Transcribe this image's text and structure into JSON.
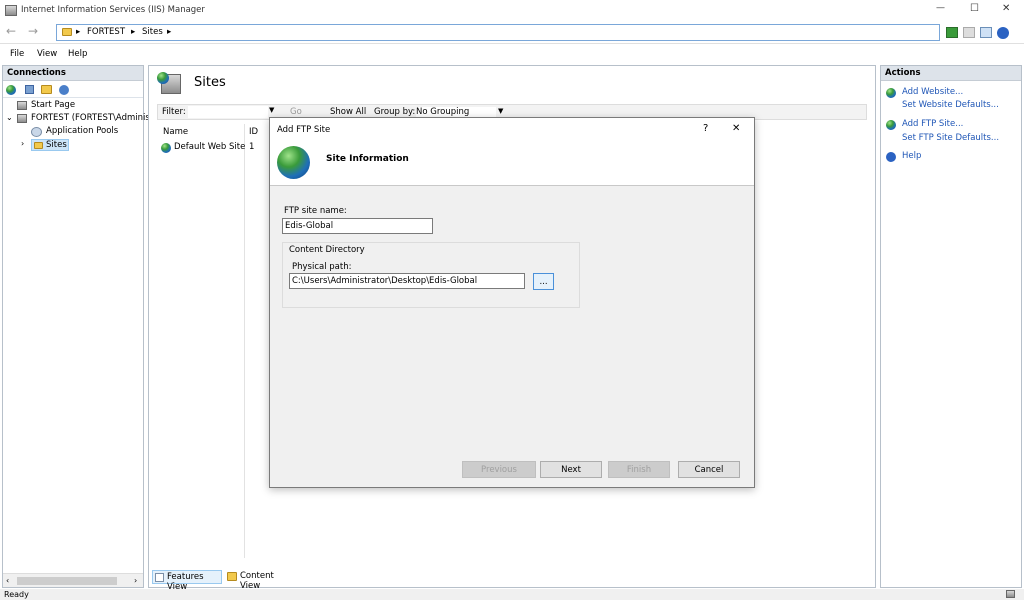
{
  "window": {
    "title": "Internet Information Services (IIS) Manager",
    "controls": {
      "minimize": "—",
      "maximize": "☐",
      "close": "✕"
    }
  },
  "address": {
    "back": "←",
    "forward": "→",
    "segments": [
      "FORTEST",
      "Sites"
    ],
    "sep": "▸"
  },
  "menu": [
    "File",
    "View",
    "Help"
  ],
  "connections": {
    "title": "Connections",
    "tree": {
      "start_page": "Start Page",
      "server": "FORTEST (FORTEST\\Administ",
      "app_pools": "Application Pools",
      "sites": "Sites"
    }
  },
  "sites": {
    "title": "Sites",
    "filter_label": "Filter:",
    "go_label": "Go",
    "show_all_label": "Show All",
    "group_by_label": "Group by:",
    "group_by_value": "No Grouping",
    "columns": {
      "name": "Name",
      "id": "ID"
    },
    "rows": [
      {
        "name": "Default Web Site",
        "id": "1"
      }
    ]
  },
  "views": {
    "features": "Features View",
    "content": "Content View"
  },
  "actions": {
    "title": "Actions",
    "add_website": "Add Website...",
    "set_website_defaults": "Set Website Defaults...",
    "add_ftp_site": "Add FTP Site...",
    "set_ftp_defaults": "Set FTP Site Defaults...",
    "help": "Help"
  },
  "dialog": {
    "title": "Add FTP Site",
    "help_glyph": "?",
    "close_glyph": "✕",
    "header": "Site Information",
    "site_name_label": "FTP site name:",
    "site_name_value": "Edis-Global",
    "content_dir_label": "Content Directory",
    "physical_path_label": "Physical path:",
    "physical_path_value": "C:\\Users\\Administrator\\Desktop\\Edis-Global",
    "browse_label": "...",
    "buttons": {
      "previous": "Previous",
      "next": "Next",
      "finish": "Finish",
      "cancel": "Cancel"
    }
  },
  "status": {
    "text": "Ready"
  }
}
